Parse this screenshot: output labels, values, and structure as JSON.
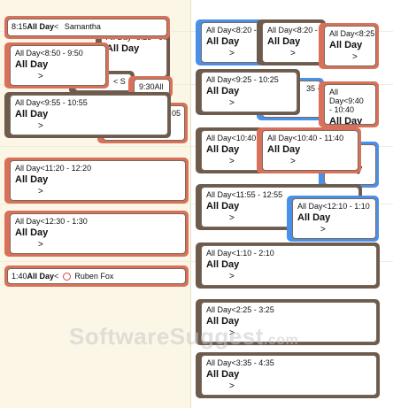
{
  "left_column": {
    "appointments": [
      {
        "time": "8:15",
        "all_day": "All Day",
        "lt": "<",
        "name": "Samantha"
      },
      {
        "title": "All Day<8:50 - 9:50",
        "subtitle": "All Day",
        "arrow": ">"
      },
      {
        "title": "All Day<9:55 - 10:55",
        "subtitle": "All Day",
        "arrow": ">"
      },
      {
        "title": "All Day<11:20 - 12:20",
        "subtitle": "All Day",
        "arrow": ">"
      },
      {
        "title": "All Day<12:30 - 1:30",
        "subtitle": "All Day",
        "arrow": ">"
      },
      {
        "time": "1:40",
        "all_day": "All Day",
        "lt": "<",
        "name": "Ruben Fox"
      }
    ],
    "fragments": {
      "f1": "All Day<8:25 - 9:25",
      "f2": "All Day",
      "f3": "<  S",
      "f4": "9:30All",
      "f5": "05"
    }
  },
  "right_column": {
    "appointments": [
      {
        "title": "All Day<8:20 -",
        "subtitle": "All Day",
        "arrow": ">"
      },
      {
        "title": "All Day<8:20 -",
        "subtitle": "All Day",
        "arrow": ">"
      },
      {
        "title": "All Day<8:25 - 9:25",
        "subtitle": "All Day",
        "arrow": ">"
      },
      {
        "title": "All Day<9:25 - 10:25",
        "subtitle": "All Day",
        "arrow": ">"
      },
      {
        "title": "All Day<9:40 - 10:40",
        "subtitle": "All Day",
        "arrow": ">"
      },
      {
        "title": "All Day<10:40 -",
        "subtitle": "All Day",
        "arrow": ">"
      },
      {
        "title": "All Day<10:40 - 11:40",
        "subtitle": "All Day",
        "arrow": ">"
      },
      {
        "title": "All Day<11:55 - 12:55",
        "subtitle": "All Day",
        "arrow": ">"
      },
      {
        "title": "All Day<12:10 - 1:10",
        "subtitle": "All Day",
        "arrow": ">"
      },
      {
        "title": "All Day<1:10 - 2:10",
        "subtitle": "All Day",
        "arrow": ">"
      },
      {
        "title": "All Day<2:25 - 3:25",
        "subtitle": "All Day",
        "arrow": ">"
      },
      {
        "title": "All Day<3:35 - 4:35",
        "subtitle": "All Day",
        "arrow": ">"
      }
    ],
    "fragments": {
      "f1": "35 -",
      "f2": ":00",
      "f3": "All Day",
      "f4": ">"
    }
  },
  "watermark": {
    "main": "SoftwareSuggest",
    "suffix": ".com"
  },
  "colors": {
    "red": "#d9705a",
    "brown": "#6d5b4e",
    "blue": "#4a90e8",
    "left_bg": "#fbf6e6"
  }
}
